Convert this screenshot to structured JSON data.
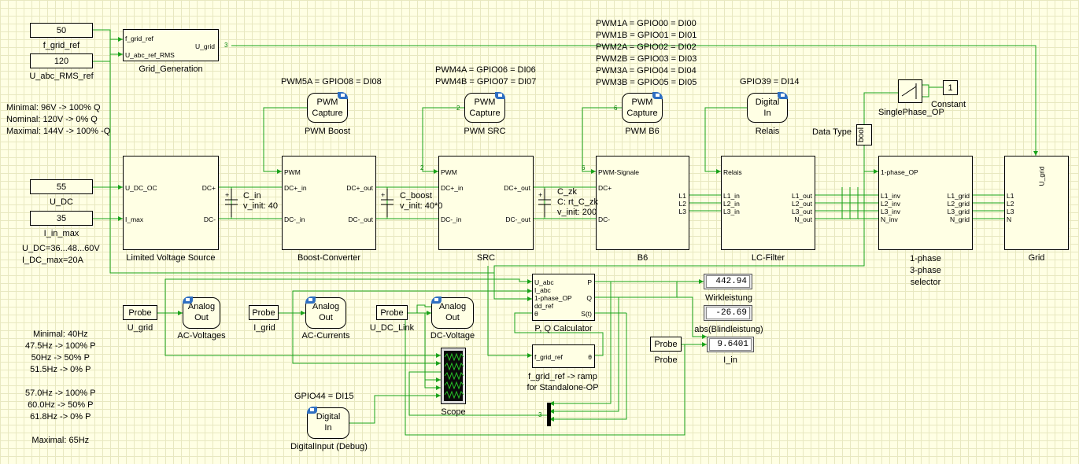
{
  "constants": {
    "f_grid_ref": "50",
    "U_abc_RMS_ref": "120",
    "U_DC": "55",
    "I_in_max": "35",
    "constant": "1"
  },
  "labels": {
    "f_grid_ref": "f_grid_ref",
    "U_abc_RMS_ref": "U_abc_RMS_ref",
    "U_DC": "U_DC",
    "I_in_max": "I_in_max",
    "grid_generation": "Grid_Generation",
    "limited_source": "Limited Voltage Source",
    "boost": "Boost-Converter",
    "src": "SRC",
    "b6": "B6",
    "lc_filter": "LC-Filter",
    "selector": "1-phase\n3-phase\nselector",
    "grid": "Grid",
    "pwm_boost": "PWM Boost",
    "pwm_src": "PWM SRC",
    "pwm_b6": "PWM B6",
    "relais": "Relais",
    "single_phase_op": "SinglePhase_OP",
    "constant": "Constant",
    "data_type": "Data Type",
    "bool": "bool",
    "pq_calc": "P, Q Calculator",
    "ramp": "f_grid_ref -> ramp\nfor Standalone-OP",
    "scope": "Scope",
    "digital_input_debug": "DigitalInput (Debug)",
    "wirkleistung": "Wirkleistung",
    "blindleistung": "abs(Blindleistung)",
    "i_in": "I_in",
    "probe": "Probe",
    "u_grid": "U_grid",
    "i_grid": "I_grid",
    "u_dc_link": "U_DC_Link",
    "ac_voltages": "AC-Voltages",
    "ac_currents": "AC-Currents",
    "dc_voltage": "DC-Voltage"
  },
  "hw_blocks": {
    "pwm_capture": "PWM\nCapture",
    "analog_out": "Analog\nOut",
    "digital_in": "Digital\nIn"
  },
  "capacitors": {
    "c_in": "C_in\nv_init: 40",
    "c_boost": "C_boost\nv_init: 40*0",
    "c_zk": "C_zk\nC: rt_C_zk\nv_init: 200"
  },
  "annotations": {
    "gpio_boost": "PWM5A = GPIO08 = DI08",
    "gpio_src": "PWM4A = GPIO06 = DI06\nPWM4B = GPIO07 = DI07",
    "gpio_b6": "PWM1A = GPIO00 = DI00\nPWM1B = GPIO01 = DI01\nPWM2A = GPIO02 = DI02\nPWM2B = GPIO03 = DI03\nPWM3A = GPIO04 = DI04\nPWM3B = GPIO05 = DI05",
    "gpio_relais": "GPIO39 = DI14",
    "gpio_debug": "GPIO44 = DI15",
    "voltage_limits": "Minimal: 96V -> 100% Q\nNominal: 120V -> 0% Q\nMaximal: 144V -> 100% -Q",
    "dc_limits": "U_DC=36...48...60V\nI_DC_max=20A",
    "freq_limits": "Minimal: 40Hz\n47.5Hz -> 100% P\n50Hz -> 50% P\n51.5Hz -> 0% P\n\n57.0Hz -> 100% P\n60.0Hz -> 50% P\n61.8Hz -> 0% P\n\nMaximal: 65Hz"
  },
  "displays": {
    "wirkleistung": "442.94",
    "blindleistung": "-26.69",
    "i_in": "9.6401"
  },
  "ports": {
    "gg_in1": "f_grid_ref",
    "gg_in2": "U_abc_ref_RMS",
    "gg_out": "U_grid",
    "lvs_in1": "U_DC_OC",
    "lvs_in2": "I_max",
    "lvs_out1": "DC+",
    "lvs_out2": "DC-",
    "bc_pwm": "PWM",
    "bc_in1": "DC+_in",
    "bc_in2": "DC-_in",
    "bc_out1": "DC+_out",
    "bc_out2": "DC-_out",
    "src_pwm": "PWM",
    "src_in1": "DC+_in",
    "src_in2": "DC-_in",
    "src_out1": "DC+_out",
    "src_out2": "DC-_out",
    "b6_pwm": "PWM-Signale",
    "b6_in1": "DC+",
    "b6_in2": "DC-",
    "b6_l1": "L1",
    "b6_l2": "L2",
    "b6_l3": "L3",
    "lc_relais": "Relais",
    "lc_l1in": "L1_in",
    "lc_l2in": "L2_in",
    "lc_l3in": "L3_in",
    "lc_l1out": "L1_out",
    "lc_l2out": "L2_out",
    "lc_l3out": "L3_out",
    "lc_nout": "N_out",
    "sel_op": "1-phase_OP",
    "sel_l1": "L1_inv",
    "sel_l2": "L2_inv",
    "sel_l3": "L3_inv",
    "sel_n": "N_inv",
    "sel_o1": "L1_grid",
    "sel_o2": "L2_grid",
    "sel_o3": "L3_grid",
    "sel_on": "N_grid",
    "grid_ug": "U_grid",
    "grid_l1": "L1",
    "grid_l2": "L2",
    "grid_l3": "L3",
    "grid_n": "N",
    "pq_uabc": "U_abc",
    "pq_iabc": "I_abc",
    "pq_op": "1-phase_OP",
    "pq_ddref": "dd_ref",
    "pq_theta": "θ",
    "pq_p": "P",
    "pq_q": "Q",
    "pq_st": "S(t)",
    "ramp_in": "f_grid_ref",
    "ramp_out": "θ"
  },
  "signal_widths": {
    "three": "3",
    "two": "2",
    "six": "6"
  },
  "colors": {
    "wire": "#1aa31a",
    "block_border": "#000000",
    "background": "#ffffe4",
    "hw_badge": "#2f6fc2"
  }
}
